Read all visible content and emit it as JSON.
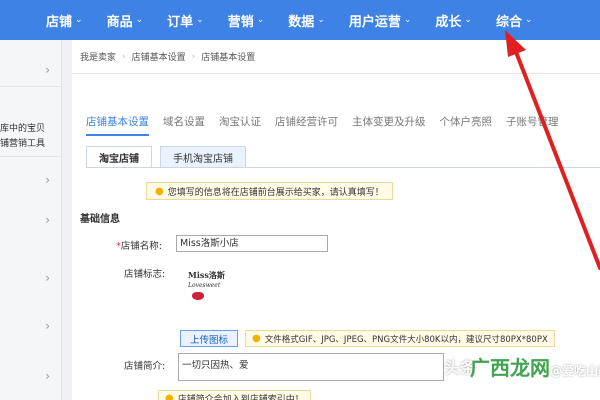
{
  "nav": {
    "items": [
      {
        "label": "店铺"
      },
      {
        "label": "商品"
      },
      {
        "label": "订单"
      },
      {
        "label": "营销"
      },
      {
        "label": "数据"
      },
      {
        "label": "用户运营"
      },
      {
        "label": "成长"
      },
      {
        "label": "综合"
      }
    ],
    "chevron": "⌄"
  },
  "sidebar": {
    "text_1": "库中的宝贝",
    "text_2": "铺营销工具"
  },
  "breadcrumb": {
    "items": [
      "我是卖家",
      "店铺基本设置",
      "店铺基本设置"
    ]
  },
  "tabs": [
    {
      "label": "店铺基本设置"
    },
    {
      "label": "域名设置"
    },
    {
      "label": "淘宝认证"
    },
    {
      "label": "店铺经营许可"
    },
    {
      "label": "主体变更及升级"
    },
    {
      "label": "个体户亮照"
    },
    {
      "label": "子账号管理"
    }
  ],
  "subtabs": [
    {
      "label": "淘宝店铺"
    },
    {
      "label": "手机淘宝店铺"
    }
  ],
  "notice": "您填写的信息将在店铺前台展示给买家，请认真填写！",
  "section_title": "基础信息",
  "form": {
    "name_label": "店铺名称:",
    "name_value": "Miss洛斯小店",
    "logo_label": "店铺标志:",
    "logo_text_1": "Miss洛斯",
    "logo_text_2": "Lovesweet",
    "upload_button": "上传图标",
    "file_hint": "文件格式GIF、JPG、JPEG、PNG文件大小80K以内，建议尺寸80PX*80PX",
    "intro_label": "店铺简介:",
    "intro_value": "一切只因热、爱",
    "intro_hint": "店铺简介会加入到店铺索引中！"
  },
  "watermark": {
    "prefix": "头条",
    "brand": "广西龙网",
    "suffix": "@爱吃山药"
  },
  "colors": {
    "nav_bg": "#3d82e4",
    "arrow": "#e02020",
    "accent": "#3d82e4"
  },
  "icons": {
    "notice": "lightbulb-icon",
    "sidebar_arrow": "chevron-right-icon",
    "annotation": "red-arrow-icon"
  }
}
